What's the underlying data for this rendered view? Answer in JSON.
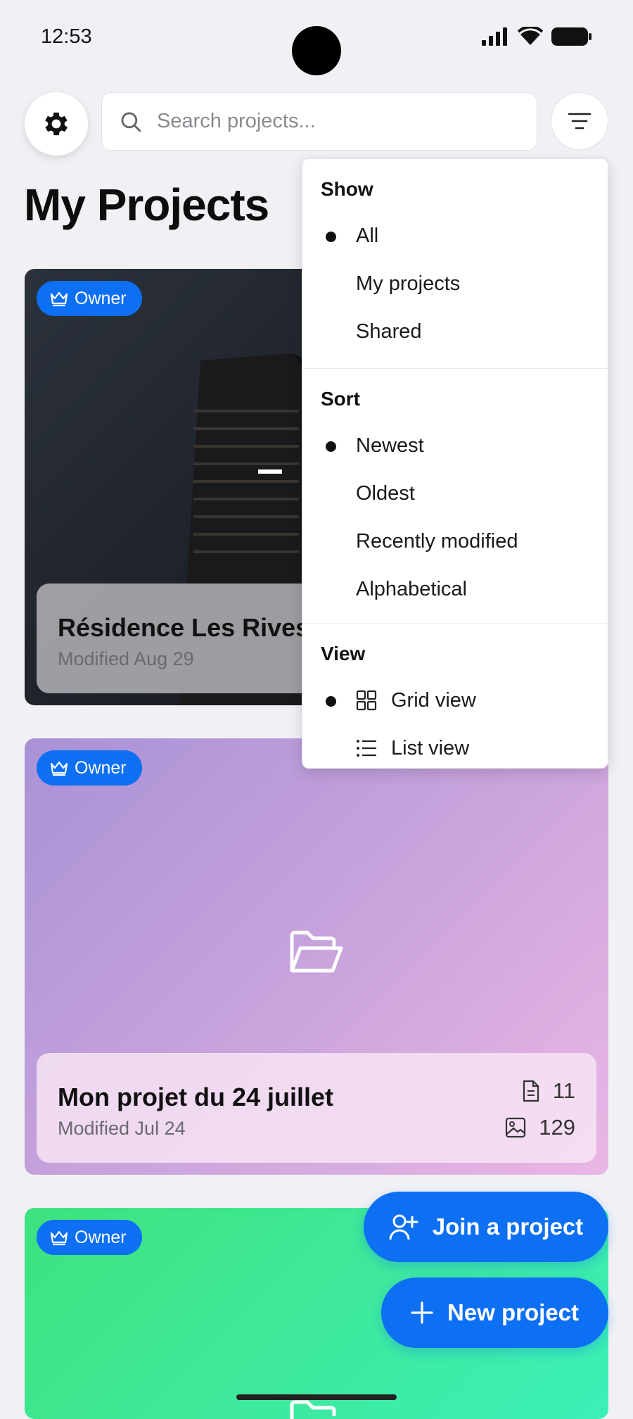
{
  "status_bar": {
    "time": "12:53"
  },
  "header": {
    "search_placeholder": "Search projects..."
  },
  "page_title": "My Projects",
  "filter_menu": {
    "show": {
      "heading": "Show",
      "options": [
        "All",
        "My projects",
        "Shared"
      ],
      "selected": "All"
    },
    "sort": {
      "heading": "Sort",
      "options": [
        "Newest",
        "Oldest",
        "Recently modified",
        "Alphabetical"
      ],
      "selected": "Newest"
    },
    "view": {
      "heading": "View",
      "options": [
        "Grid view",
        "List view"
      ],
      "selected": "Grid view"
    }
  },
  "projects": [
    {
      "badge": "Owner",
      "title": "Résidence Les Rives",
      "modified": "Modified Aug 29"
    },
    {
      "badge": "Owner",
      "title": "Mon projet du 24 juillet",
      "modified": "Modified Jul 24",
      "documents": "11",
      "photos": "129"
    },
    {
      "badge": "Owner"
    }
  ],
  "fab": {
    "join": "Join a project",
    "new": "New project"
  },
  "colors": {
    "accent": "#0d6ff2",
    "background": "#f1f1f5"
  },
  "icons": [
    "gear-icon",
    "search-icon",
    "filter-icon",
    "crown-icon",
    "folder-open-icon",
    "document-icon",
    "image-icon",
    "grid-icon",
    "list-icon",
    "user-plus-icon",
    "plus-icon"
  ]
}
